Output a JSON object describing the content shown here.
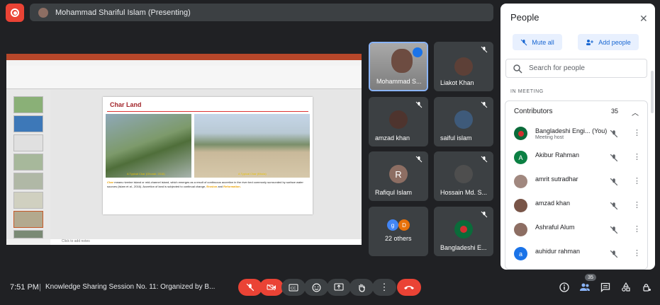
{
  "presenter": {
    "label": "Mohammad Shariful Islam (Presenting)"
  },
  "slide": {
    "title": "Char Land",
    "caption_left": "A Typical Char (Ghorair, 2016)",
    "caption_right": "A Typical Char (Bhola)",
    "notes": "Click to add notes",
    "text_char": "Char",
    "body_text": "means riverine island or mid-channel island, which emerges as a result of continuous accretion in the river bed commonly surrounded by surface water sources (Islam et al., 2016). Accretion of land is subjected to continual change,",
    "erosion": "Erosion",
    "and": "and",
    "reformation": "Reformation."
  },
  "tiles": [
    {
      "name": "Mohammad S...",
      "face": "#6d4c41"
    },
    {
      "name": "Liakot Khan",
      "face": "#5d4037"
    },
    {
      "name": "amzad khan",
      "face": "#4e342e"
    },
    {
      "name": "saiful islam",
      "face": "#3e5a7a"
    },
    {
      "name": "Rafiqul Islam",
      "initial": "R",
      "face": "#8d6e63"
    },
    {
      "name": "Hossain Md. S...",
      "face": "#4e4e4e"
    },
    {
      "name": "22 others",
      "initials": [
        "g",
        "D"
      ]
    },
    {
      "name": "Bangladeshi E...",
      "face": "#0b6b3a"
    }
  ],
  "people": {
    "title": "People",
    "mute_all": "Mute all",
    "add_people": "Add people",
    "search_placeholder": "Search for people",
    "in_meeting": "IN MEETING",
    "contributors_label": "Contributors",
    "contributors_count": "35",
    "list": [
      {
        "name": "Bangladeshi Engi...",
        "you": "(You)",
        "sub": "Meeting host",
        "color": "#0b6b3a"
      },
      {
        "name": "Akibur Rahman",
        "initial": "A",
        "color": "#0b8043"
      },
      {
        "name": "amrit sutradhar",
        "color": "#a1887f"
      },
      {
        "name": "amzad khan",
        "color": "#795548"
      },
      {
        "name": "Ashraful Alum",
        "color": "#8d6e63"
      },
      {
        "name": "auhidur rahman",
        "initial": "a",
        "color": "#1a73e8"
      }
    ]
  },
  "bottom": {
    "time": "7:51 PM",
    "separator": "|",
    "meeting_title": "Knowledge Sharing Session No. 11: Organized by B...",
    "participant_count": "35"
  },
  "colors": {
    "accent_red": "#ea4335",
    "accent_blue": "#1a73e8",
    "bg": "#202124",
    "tile": "#3c4043"
  }
}
